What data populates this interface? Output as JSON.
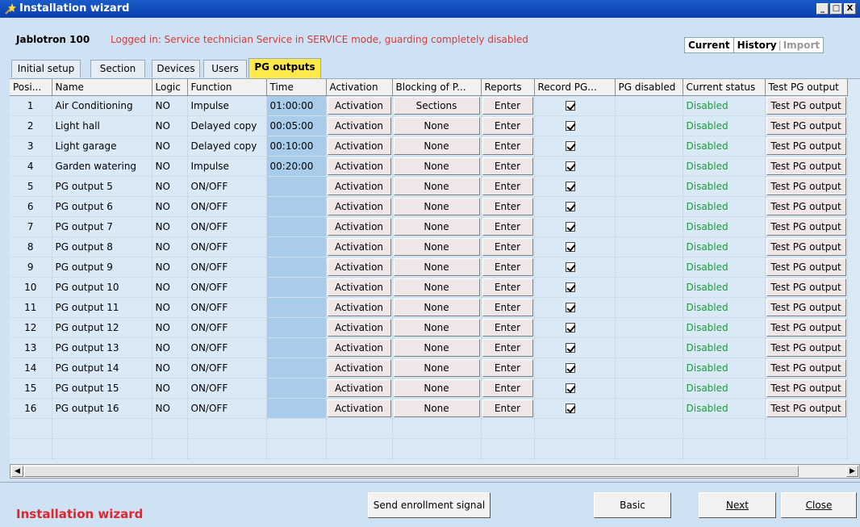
{
  "window": {
    "title": "Installation wizard",
    "min_glyph": "_",
    "max_glyph": "□",
    "close_glyph": "X"
  },
  "info": {
    "system": "Jablotron 100",
    "login_status": "Logged in: Service technician Service in SERVICE mode, guarding completely disabled"
  },
  "modes": {
    "current": "Current",
    "history": "History",
    "separator": "|",
    "import": "Import"
  },
  "tabs": [
    "Initial setup",
    "Section",
    "Devices",
    "Users",
    "PG outputs"
  ],
  "table": {
    "columns": [
      "Posi...",
      "Name",
      "Logic",
      "Function",
      "Time",
      "Activation",
      "Blocking of P...",
      "Reports",
      "Record PG...",
      "PG disabled",
      "Current status",
      "Test PG output"
    ],
    "rows": [
      {
        "pos": "1",
        "name": "Air Conditioning",
        "logic": "NO",
        "function": "Impulse",
        "time": "01:00:00",
        "activation": "Activation",
        "blocking": "Sections",
        "reports": "Enter",
        "record": true,
        "status": "Disabled",
        "test": "Test PG output"
      },
      {
        "pos": "2",
        "name": "Light hall",
        "logic": "NO",
        "function": "Delayed copy",
        "time": "00:05:00",
        "activation": "Activation",
        "blocking": "None",
        "reports": "Enter",
        "record": true,
        "status": "Disabled",
        "test": "Test PG output"
      },
      {
        "pos": "3",
        "name": "Light garage",
        "logic": "NO",
        "function": "Delayed copy",
        "time": "00:10:00",
        "activation": "Activation",
        "blocking": "None",
        "reports": "Enter",
        "record": true,
        "status": "Disabled",
        "test": "Test PG output"
      },
      {
        "pos": "4",
        "name": "Garden watering",
        "logic": "NO",
        "function": "Impulse",
        "time": "00:20:00",
        "activation": "Activation",
        "blocking": "None",
        "reports": "Enter",
        "record": true,
        "status": "Disabled",
        "test": "Test PG output"
      },
      {
        "pos": "5",
        "name": "PG output 5",
        "logic": "NO",
        "function": "ON/OFF",
        "time": "",
        "activation": "Activation",
        "blocking": "None",
        "reports": "Enter",
        "record": true,
        "status": "Disabled",
        "test": "Test PG output"
      },
      {
        "pos": "6",
        "name": "PG output 6",
        "logic": "NO",
        "function": "ON/OFF",
        "time": "",
        "activation": "Activation",
        "blocking": "None",
        "reports": "Enter",
        "record": true,
        "status": "Disabled",
        "test": "Test PG output"
      },
      {
        "pos": "7",
        "name": "PG output 7",
        "logic": "NO",
        "function": "ON/OFF",
        "time": "",
        "activation": "Activation",
        "blocking": "None",
        "reports": "Enter",
        "record": true,
        "status": "Disabled",
        "test": "Test PG output"
      },
      {
        "pos": "8",
        "name": "PG output 8",
        "logic": "NO",
        "function": "ON/OFF",
        "time": "",
        "activation": "Activation",
        "blocking": "None",
        "reports": "Enter",
        "record": true,
        "status": "Disabled",
        "test": "Test PG output"
      },
      {
        "pos": "9",
        "name": "PG output 9",
        "logic": "NO",
        "function": "ON/OFF",
        "time": "",
        "activation": "Activation",
        "blocking": "None",
        "reports": "Enter",
        "record": true,
        "status": "Disabled",
        "test": "Test PG output"
      },
      {
        "pos": "10",
        "name": "PG output 10",
        "logic": "NO",
        "function": "ON/OFF",
        "time": "",
        "activation": "Activation",
        "blocking": "None",
        "reports": "Enter",
        "record": true,
        "status": "Disabled",
        "test": "Test PG output"
      },
      {
        "pos": "11",
        "name": "PG output 11",
        "logic": "NO",
        "function": "ON/OFF",
        "time": "",
        "activation": "Activation",
        "blocking": "None",
        "reports": "Enter",
        "record": true,
        "status": "Disabled",
        "test": "Test PG output"
      },
      {
        "pos": "12",
        "name": "PG output 12",
        "logic": "NO",
        "function": "ON/OFF",
        "time": "",
        "activation": "Activation",
        "blocking": "None",
        "reports": "Enter",
        "record": true,
        "status": "Disabled",
        "test": "Test PG output"
      },
      {
        "pos": "13",
        "name": "PG output 13",
        "logic": "NO",
        "function": "ON/OFF",
        "time": "",
        "activation": "Activation",
        "blocking": "None",
        "reports": "Enter",
        "record": true,
        "status": "Disabled",
        "test": "Test PG output"
      },
      {
        "pos": "14",
        "name": "PG output 14",
        "logic": "NO",
        "function": "ON/OFF",
        "time": "",
        "activation": "Activation",
        "blocking": "None",
        "reports": "Enter",
        "record": true,
        "status": "Disabled",
        "test": "Test PG output"
      },
      {
        "pos": "15",
        "name": "PG output 15",
        "logic": "NO",
        "function": "ON/OFF",
        "time": "",
        "activation": "Activation",
        "blocking": "None",
        "reports": "Enter",
        "record": true,
        "status": "Disabled",
        "test": "Test PG output"
      },
      {
        "pos": "16",
        "name": "PG output 16",
        "logic": "NO",
        "function": "ON/OFF",
        "time": "",
        "activation": "Activation",
        "blocking": "None",
        "reports": "Enter",
        "record": true,
        "status": "Disabled",
        "test": "Test PG output"
      }
    ]
  },
  "scroll": {
    "left_glyph": "◀",
    "right_glyph": "▶"
  },
  "footer": {
    "brand": "Installation wizard",
    "send_enrollment": "Send enrollment signal",
    "basic": "Basic",
    "next": "Next",
    "close": "Close"
  },
  "colors": {
    "titlebar": "#0a3fae",
    "active_tab": "#ffe94a",
    "status_green": "#1d9a3b",
    "brand_red": "#e0252c",
    "login_red": "#d23b3b"
  }
}
